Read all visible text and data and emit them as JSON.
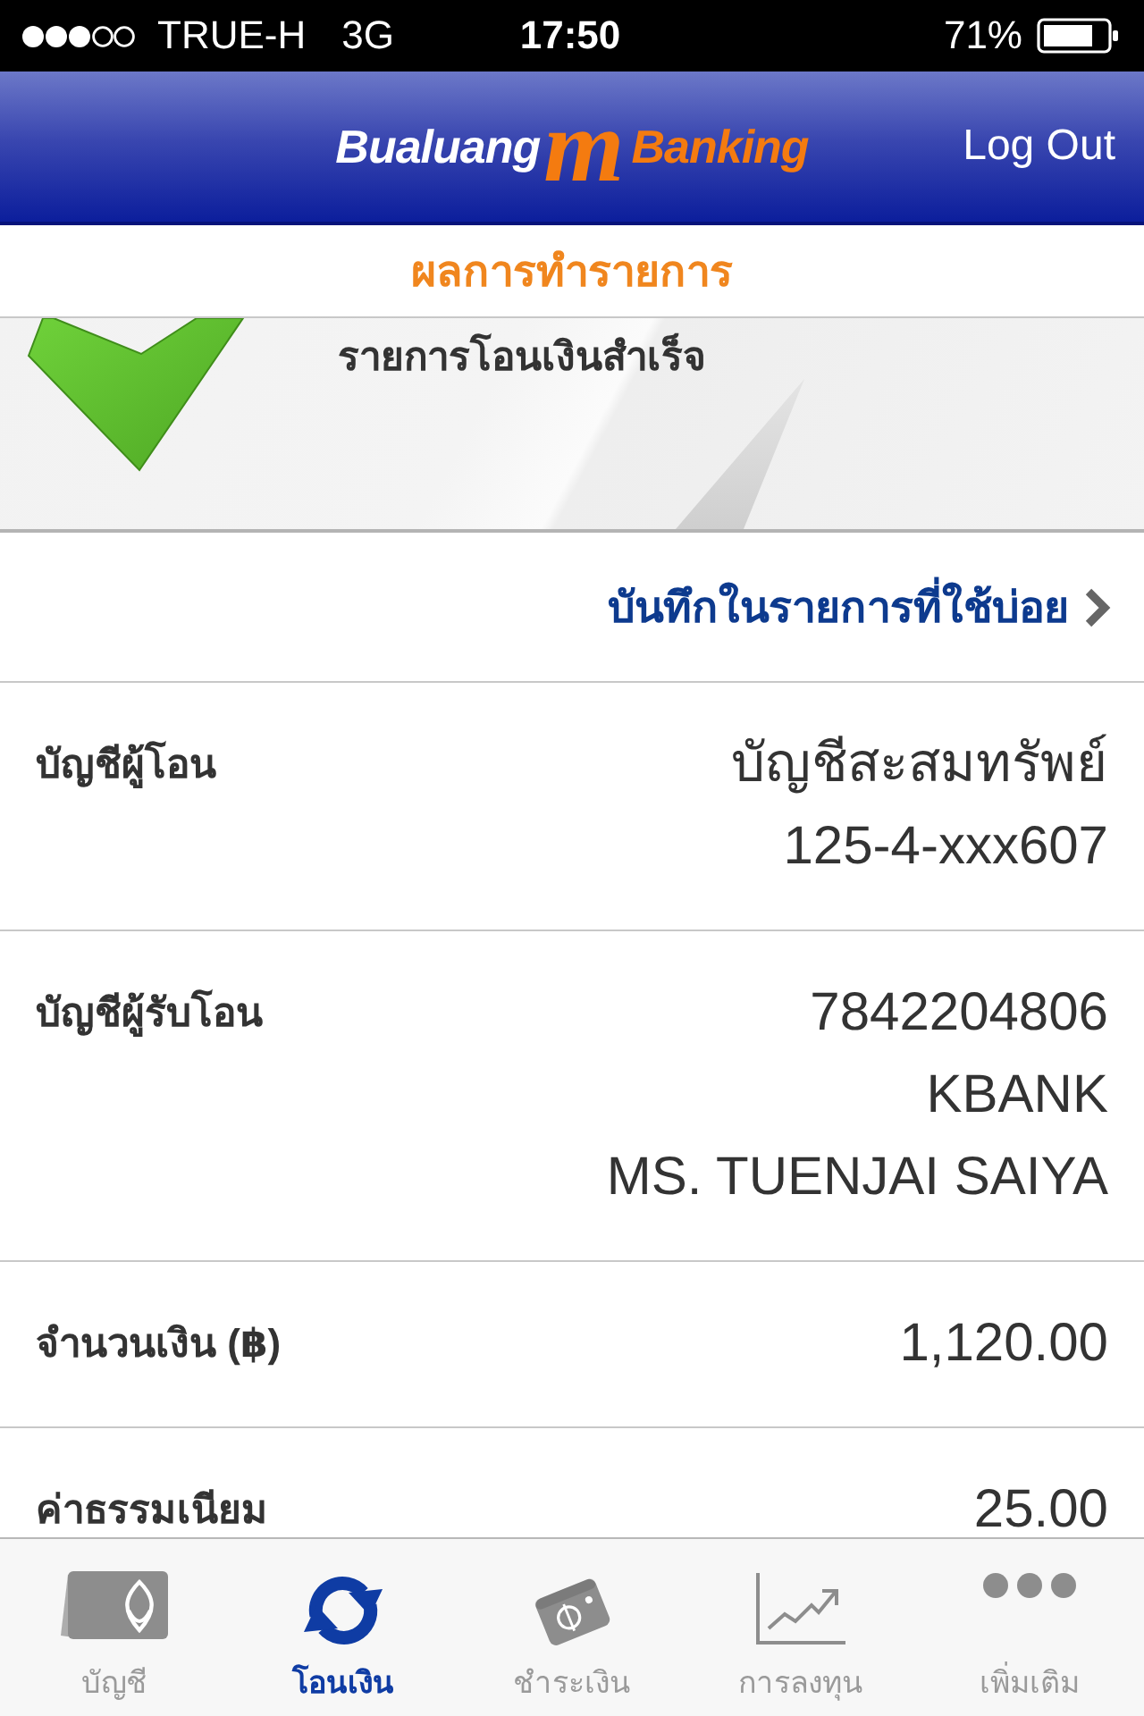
{
  "status_bar": {
    "carrier": "TRUE-H",
    "network": "3G",
    "time": "17:50",
    "battery": "71%"
  },
  "header": {
    "logo": {
      "text_1": "Bualuang",
      "mark": "m",
      "text_2": "Banking"
    },
    "logout": "Log Out"
  },
  "page_title": "ผลการทำรายการ",
  "result": {
    "message": "รายการโอนเงินสำเร็จ"
  },
  "save_link": "บันทึกในรายการที่ใช้บ่อย",
  "details": [
    {
      "label": "บัญชีผู้โอน",
      "values": [
        "บัญชีสะสมทรัพย์",
        "125-4-xxx607"
      ]
    },
    {
      "label": "บัญชีผู้รับโอน",
      "values": [
        "7842204806",
        "KBANK",
        "MS. TUENJAI SAIYA"
      ]
    },
    {
      "label": "จำนวนเงิน (฿)",
      "values": [
        "1,120.00"
      ]
    },
    {
      "label": "ค่าธรรมเนียม",
      "values": [
        "25.00"
      ]
    }
  ],
  "tab_bar": {
    "tabs": [
      {
        "label": "บัญชี",
        "selected": false
      },
      {
        "label": "โอนเงิน",
        "selected": true
      },
      {
        "label": "ชำระเงิน",
        "selected": false
      },
      {
        "label": "การลงทุน",
        "selected": false
      },
      {
        "label": "เพิ่มเติม",
        "selected": false
      }
    ]
  }
}
